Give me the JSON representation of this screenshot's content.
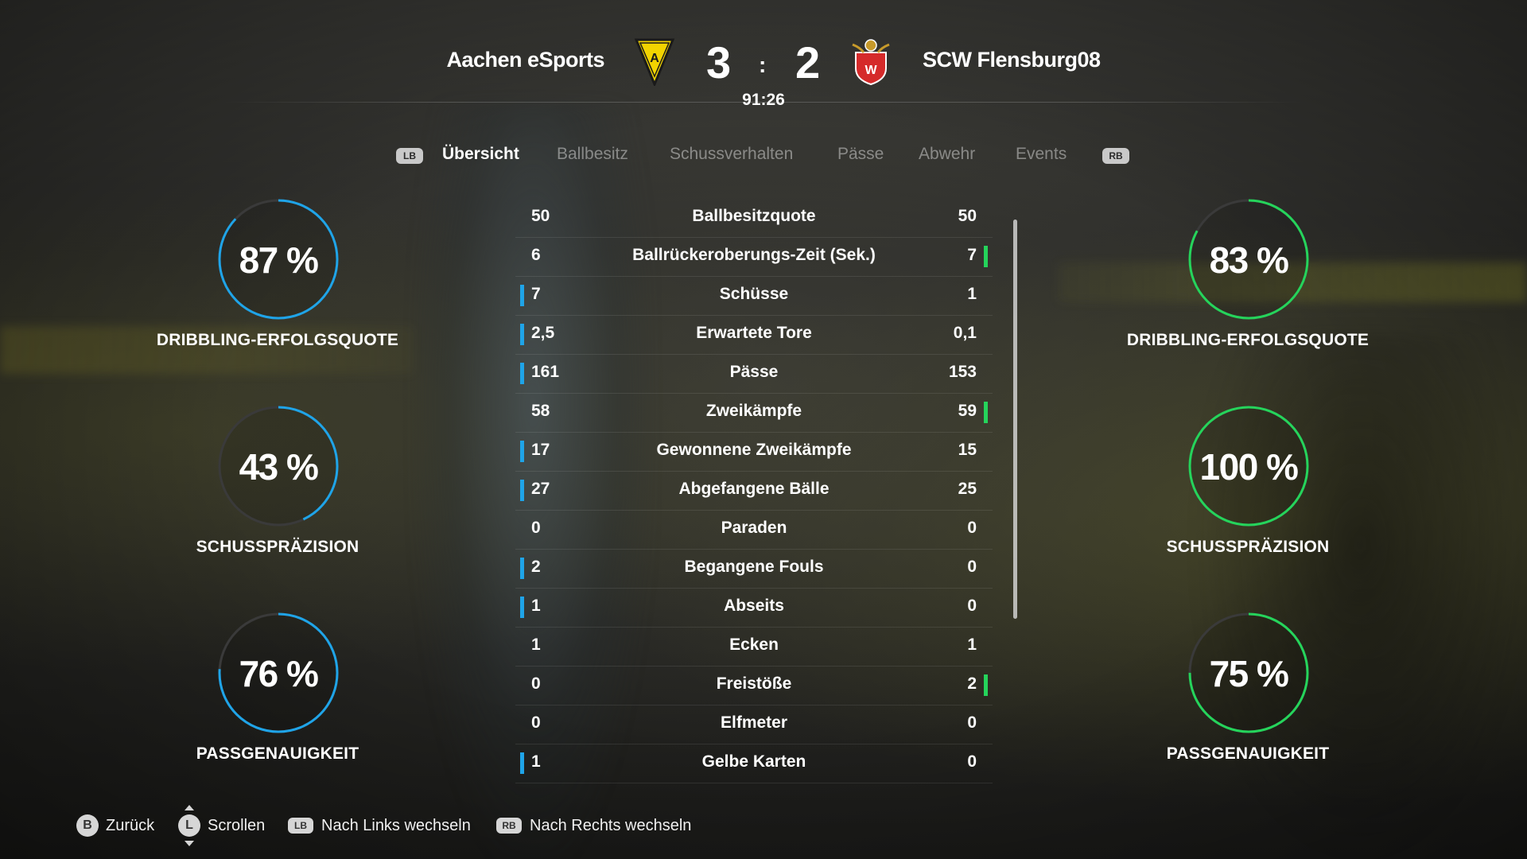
{
  "header": {
    "home_team": "Aachen eSports",
    "away_team": "SCW Flensburg08",
    "home_score": "3",
    "separator": ":",
    "away_score": "2",
    "clock": "91:26",
    "home_crest_text": "A",
    "away_crest_text": "W"
  },
  "tabs": {
    "left_bumper": "LB",
    "right_bumper": "RB",
    "items": [
      {
        "label": "Übersicht",
        "active": true
      },
      {
        "label": "Ballbesitz",
        "active": false
      },
      {
        "label": "Schussverhalten",
        "active": false
      },
      {
        "label": "Pässe",
        "active": false
      },
      {
        "label": "Abwehr",
        "active": false
      },
      {
        "label": "Events",
        "active": false
      }
    ]
  },
  "stats": [
    {
      "label": "Ballbesitzquote",
      "home": "50",
      "away": "50",
      "leader": "none"
    },
    {
      "label": "Ballrückeroberungs-Zeit (Sek.)",
      "home": "6",
      "away": "7",
      "leader": "away"
    },
    {
      "label": "Schüsse",
      "home": "7",
      "away": "1",
      "leader": "home"
    },
    {
      "label": "Erwartete Tore",
      "home": "2,5",
      "away": "0,1",
      "leader": "home"
    },
    {
      "label": "Pässe",
      "home": "161",
      "away": "153",
      "leader": "home"
    },
    {
      "label": "Zweikämpfe",
      "home": "58",
      "away": "59",
      "leader": "away"
    },
    {
      "label": "Gewonnene Zweikämpfe",
      "home": "17",
      "away": "15",
      "leader": "home"
    },
    {
      "label": "Abgefangene Bälle",
      "home": "27",
      "away": "25",
      "leader": "home"
    },
    {
      "label": "Paraden",
      "home": "0",
      "away": "0",
      "leader": "none"
    },
    {
      "label": "Begangene Fouls",
      "home": "2",
      "away": "0",
      "leader": "home"
    },
    {
      "label": "Abseits",
      "home": "1",
      "away": "0",
      "leader": "home"
    },
    {
      "label": "Ecken",
      "home": "1",
      "away": "1",
      "leader": "none"
    },
    {
      "label": "Freistöße",
      "home": "0",
      "away": "2",
      "leader": "away"
    },
    {
      "label": "Elfmeter",
      "home": "0",
      "away": "0",
      "leader": "none"
    },
    {
      "label": "Gelbe Karten",
      "home": "1",
      "away": "0",
      "leader": "home"
    }
  ],
  "gauges": {
    "home": [
      {
        "value_text": "87 %",
        "value": 87,
        "label": "DRIBBLING-ERFOLGSQUOTE"
      },
      {
        "value_text": "43 %",
        "value": 43,
        "label": "SCHUSSPRÄZISION"
      },
      {
        "value_text": "76 %",
        "value": 76,
        "label": "PASSGENAUIGKEIT"
      }
    ],
    "away": [
      {
        "value_text": "83 %",
        "value": 83,
        "label": "DRIBBLING-ERFOLGSQUOTE"
      },
      {
        "value_text": "100 %",
        "value": 100,
        "label": "SCHUSSPRÄZISION"
      },
      {
        "value_text": "75 %",
        "value": 75,
        "label": "PASSGENAUIGKEIT"
      }
    ]
  },
  "colors": {
    "home_accent": "#1fa4e8",
    "away_accent": "#25d45b",
    "gauge_track": "#3a3a3a"
  },
  "footer": {
    "back_button": "B",
    "back_label": "Zurück",
    "scroll_button": "L",
    "scroll_label": "Scrollen",
    "left_button": "LB",
    "left_label": "Nach Links wechseln",
    "right_button": "RB",
    "right_label": "Nach Rechts wechseln"
  }
}
